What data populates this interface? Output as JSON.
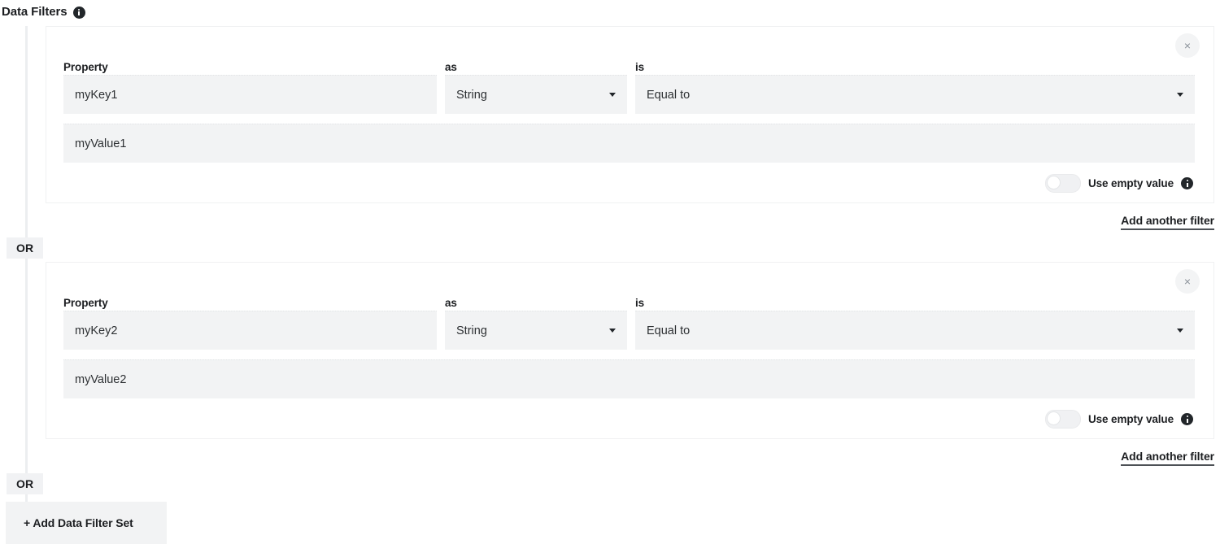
{
  "header": {
    "title": "Data Filters",
    "info_icon": "info-icon"
  },
  "filter_sets": [
    {
      "close_label": "×",
      "labels": {
        "property": "Property",
        "as": "as",
        "is": "is"
      },
      "property_value": "myKey1",
      "type_value": "String",
      "operator_value": "Equal to",
      "filter_value": "myValue1",
      "empty_toggle": {
        "label": "Use empty value",
        "state": "off",
        "info_icon": "info-icon"
      },
      "add_filter_label": "Add another filter",
      "connector": "OR"
    },
    {
      "close_label": "×",
      "labels": {
        "property": "Property",
        "as": "as",
        "is": "is"
      },
      "property_value": "myKey2",
      "type_value": "String",
      "operator_value": "Equal to",
      "filter_value": "myValue2",
      "empty_toggle": {
        "label": "Use empty value",
        "state": "off",
        "info_icon": "info-icon"
      },
      "add_filter_label": "Add another filter",
      "connector": "OR"
    }
  ],
  "add_set_button": {
    "label": "+ Add Data Filter Set"
  },
  "colors": {
    "page_background": "#ffffff",
    "field_background": "#f2f3f4",
    "badge_background": "#f1f2f4",
    "rail": "#eceef0",
    "text": "#1c1e21",
    "card_border": "#f0f1f2",
    "underline": "#4d5156"
  }
}
